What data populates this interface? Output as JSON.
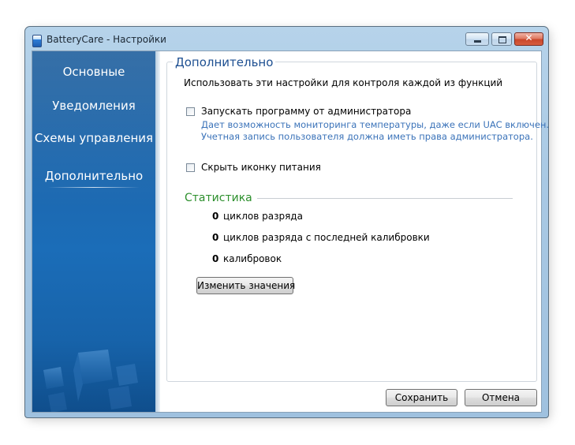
{
  "window": {
    "title": "BatteryCare - Настройки",
    "buttons": {
      "minimize_icon": "minimize-icon",
      "maximize_icon": "maximize-icon",
      "close_glyph": "✕"
    }
  },
  "sidebar": {
    "items": [
      {
        "label": "Основные"
      },
      {
        "label": "Уведомления"
      },
      {
        "label": "Схемы управления"
      },
      {
        "label": "Дополнительно",
        "active": true
      }
    ]
  },
  "main": {
    "section_title": "Дополнительно",
    "intro": "Использовать эти настройки для контроля каждой из функций",
    "run_as_admin": {
      "label": "Запускать программу от администратора",
      "checked": false,
      "hint_line1": "Дает возможность мониторинга температуры, даже если UAC включен.",
      "hint_line2": "Учетная запись пользователя должна иметь права администратора."
    },
    "hide_icon": {
      "label": "Скрыть иконку питания",
      "checked": false
    },
    "stats": {
      "title": "Статистика",
      "rows": [
        {
          "value": "0",
          "label": "циклов разряда"
        },
        {
          "value": "0",
          "label": "циклов разряда с последней калибровки"
        },
        {
          "value": "0",
          "label": "калибровок"
        }
      ],
      "edit_button": "Изменить значения"
    }
  },
  "footer": {
    "save": "Сохранить",
    "cancel": "Отмена"
  },
  "colors": {
    "sidebar": "#1b6db8",
    "section_title": "#1d4f91",
    "hint": "#3b73b9",
    "stats_title": "#2c8f2c"
  }
}
